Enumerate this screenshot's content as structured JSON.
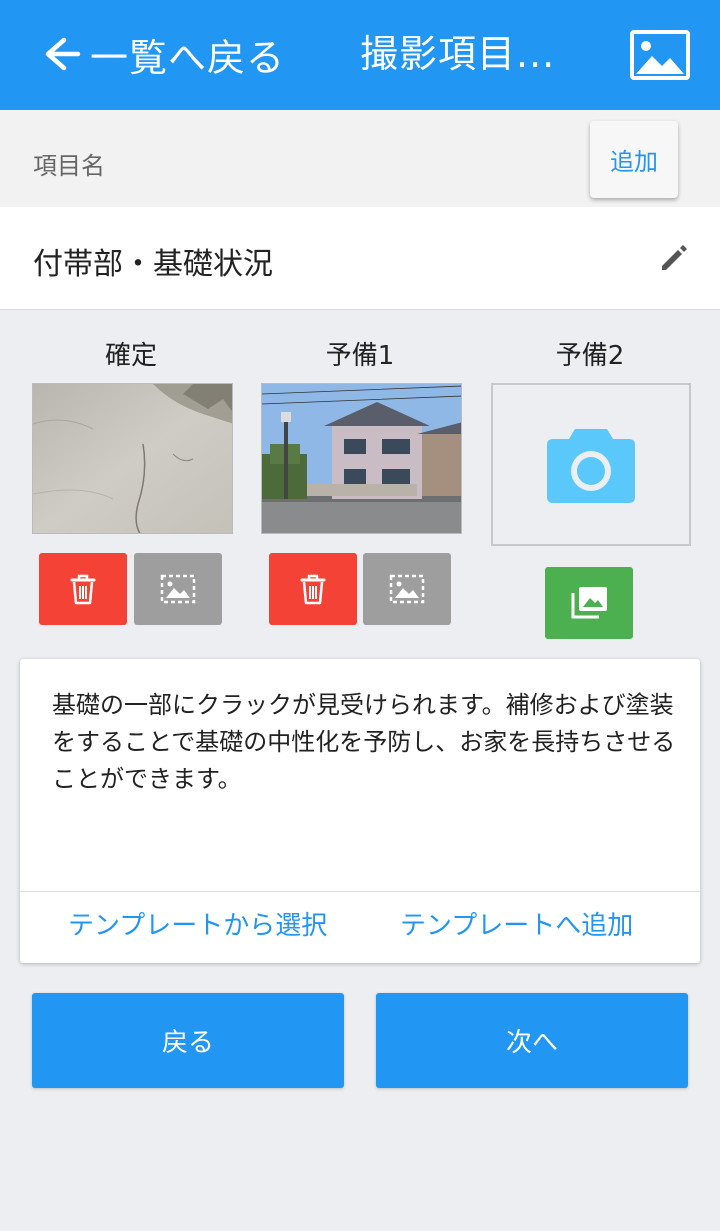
{
  "appbar": {
    "back_label": "一覧へ戻る",
    "title": "撮影項目...",
    "color": "#2196f3",
    "back_icon": "arrow-left-icon",
    "gallery_icon": "image-icon"
  },
  "item_name": {
    "label": "項目名",
    "add_label": "追加",
    "value": "付帯部・基礎状況",
    "edit_icon": "pencil-icon"
  },
  "slots": [
    {
      "label": "確定",
      "has_photo": true
    },
    {
      "label": "予備1",
      "has_photo": true
    },
    {
      "label": "予備2",
      "has_photo": false
    }
  ],
  "comment": {
    "text": "基礎の一部にクラックが見受けられます。補修および塗装をすることで基礎の中性化を予防し、お家を長持ちさせることができます。",
    "select_template": "テンプレートから選択",
    "add_template": "テンプレートへ追加"
  },
  "buttons": {
    "back": "戻る",
    "next": "次へ"
  },
  "colors": {
    "delete": "#f44336",
    "crop": "#9e9e9e",
    "gallery": "#4caf50",
    "camera": "#5ac8fa"
  }
}
